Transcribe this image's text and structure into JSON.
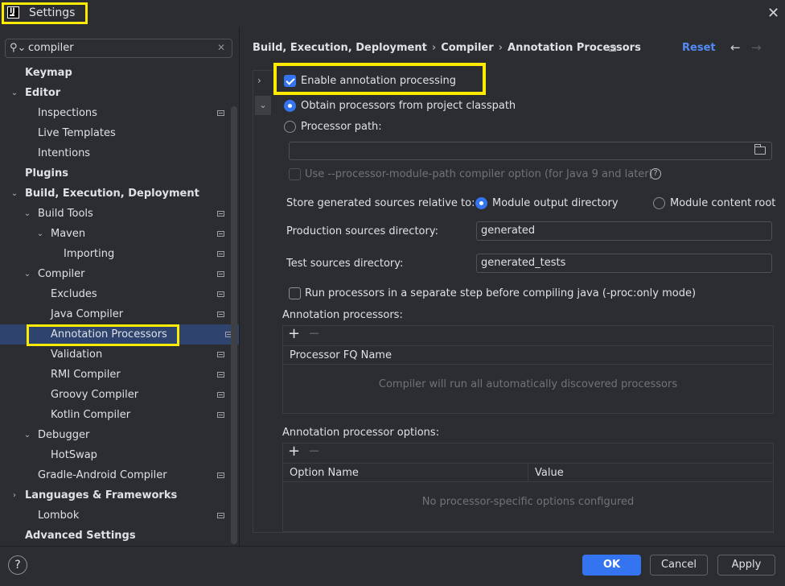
{
  "window": {
    "title": "Settings",
    "app_icon": "IJ",
    "close_icon": "close-icon"
  },
  "colors": {
    "accent": "#3574f0",
    "selection": "#2e436e",
    "highlight": "#ffeb00",
    "link": "#548af7"
  },
  "search": {
    "value": "compiler",
    "icon": "search-icon"
  },
  "sidebar": {
    "items": [
      {
        "label": "Keymap",
        "bold": true
      },
      {
        "label": "Editor",
        "bold": true,
        "expanded": true
      },
      {
        "label": "Inspections"
      },
      {
        "label": "Live Templates"
      },
      {
        "label": "Intentions"
      },
      {
        "label": "Plugins",
        "bold": true
      },
      {
        "label": "Build, Execution, Deployment",
        "bold": true,
        "expanded": true
      },
      {
        "label": "Build Tools",
        "expanded": true
      },
      {
        "label": "Maven",
        "expanded": true
      },
      {
        "label": "Importing"
      },
      {
        "label": "Compiler",
        "expanded": true
      },
      {
        "label": "Excludes"
      },
      {
        "label": "Java Compiler"
      },
      {
        "label": "Annotation Processors",
        "selected": true
      },
      {
        "label": "Validation"
      },
      {
        "label": "RMI Compiler"
      },
      {
        "label": "Groovy Compiler"
      },
      {
        "label": "Kotlin Compiler"
      },
      {
        "label": "Debugger",
        "expanded": true
      },
      {
        "label": "HotSwap"
      },
      {
        "label": "Gradle-Android Compiler"
      },
      {
        "label": "Languages & Frameworks",
        "bold": true,
        "collapsed": true
      },
      {
        "label": "Lombok"
      },
      {
        "label": "Advanced Settings",
        "bold": true
      }
    ]
  },
  "header": {
    "breadcrumb": [
      "Build, Execution, Deployment",
      "Compiler",
      "Annotation Processors"
    ],
    "separator": "›",
    "reset_label": "Reset",
    "back_icon": "arrow-left-icon",
    "forward_icon": "arrow-right-icon"
  },
  "main": {
    "enable_label": "Enable annotation processing",
    "enable_checked": true,
    "obtain_label": "Obtain processors from project classpath",
    "processor_path_label": "Processor path:",
    "processor_path_value": "",
    "module_path_label": "Use --processor-module-path compiler option (for Java 9 and later)",
    "store_label": "Store generated sources relative to:",
    "module_output_label": "Module output directory",
    "module_content_label": "Module content root",
    "production_label": "Production sources directory:",
    "production_value": "generated",
    "test_label": "Test sources directory:",
    "test_value": "generated_tests",
    "run_separate_label": "Run processors in a separate step before compiling java (-proc:only mode)",
    "processors_section": "Annotation processors:",
    "processors_column": "Processor FQ Name",
    "processors_empty": "Compiler will run all automatically discovered processors",
    "options_section": "Annotation processor options:",
    "options_columns": [
      "Option Name",
      "Value"
    ],
    "options_empty": "No processor-specific options configured",
    "add_glyph": "+",
    "remove_glyph": "−"
  },
  "footer": {
    "help_glyph": "?",
    "ok_label": "OK",
    "cancel_label": "Cancel",
    "apply_label": "Apply"
  }
}
